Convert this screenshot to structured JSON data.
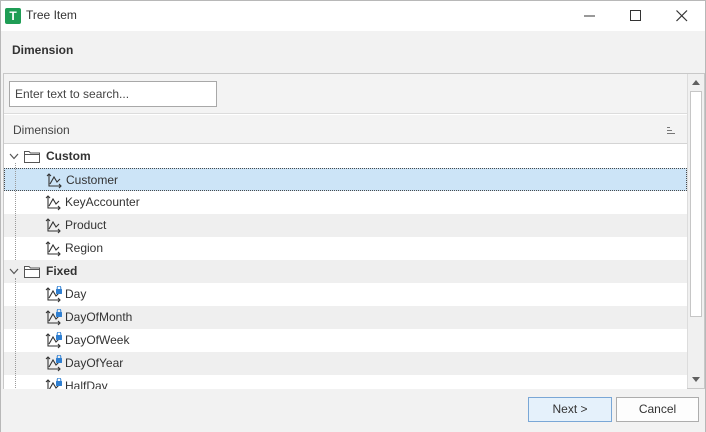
{
  "window": {
    "app_icon_letter": "T",
    "title": "Tree Item",
    "controls": [
      "minimize",
      "maximize",
      "close"
    ]
  },
  "header": {
    "title": "Dimension"
  },
  "search": {
    "placeholder": "Enter text to search...",
    "value": ""
  },
  "grid": {
    "column_header": "Dimension"
  },
  "tree": [
    {
      "label": "Custom",
      "type": "group",
      "expanded": true,
      "selected": false
    },
    {
      "label": "Customer",
      "type": "dimension",
      "locked": false,
      "selected": true
    },
    {
      "label": "KeyAccounter",
      "type": "dimension",
      "locked": false,
      "selected": false
    },
    {
      "label": "Product",
      "type": "dimension",
      "locked": false,
      "selected": false
    },
    {
      "label": "Region",
      "type": "dimension",
      "locked": false,
      "selected": false
    },
    {
      "label": "Fixed",
      "type": "group",
      "expanded": true,
      "selected": false
    },
    {
      "label": "Day",
      "type": "dimension",
      "locked": true,
      "selected": false
    },
    {
      "label": "DayOfMonth",
      "type": "dimension",
      "locked": true,
      "selected": false
    },
    {
      "label": "DayOfWeek",
      "type": "dimension",
      "locked": true,
      "selected": false
    },
    {
      "label": "DayOfYear",
      "type": "dimension",
      "locked": true,
      "selected": false
    },
    {
      "label": "HalfDay",
      "type": "dimension",
      "locked": true,
      "selected": false
    }
  ],
  "footer": {
    "next_label": "Next >",
    "cancel_label": "Cancel"
  },
  "colors": {
    "selection": "#cce4f7",
    "app_icon": "#1f9d55",
    "lock": "#2f7fd1"
  }
}
